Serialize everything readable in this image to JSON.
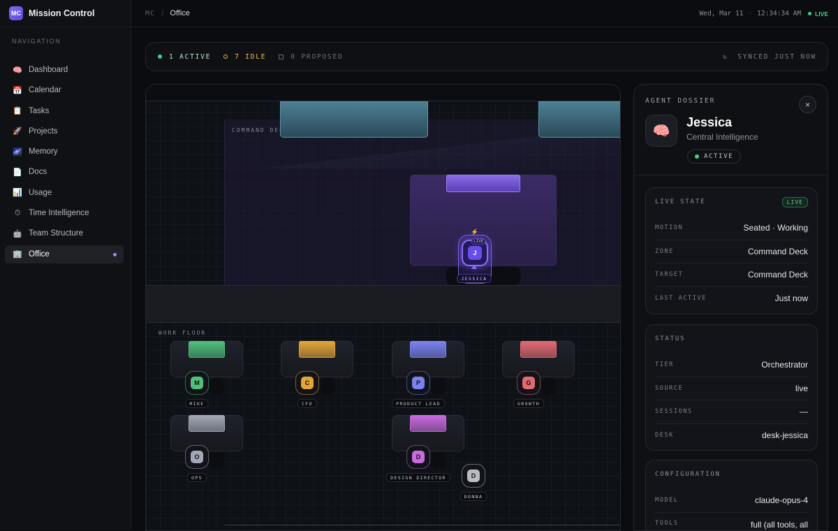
{
  "app": {
    "logo": "MC",
    "title": "Mission Control"
  },
  "sidebar": {
    "heading": "NAVIGATION",
    "items": [
      {
        "icon": "🧠",
        "icon_name": "brain-icon",
        "label": "Dashboard"
      },
      {
        "icon": "📅",
        "icon_name": "calendar-icon",
        "label": "Calendar"
      },
      {
        "icon": "📋",
        "icon_name": "clipboard-icon",
        "label": "Tasks"
      },
      {
        "icon": "🚀",
        "icon_name": "rocket-icon",
        "label": "Projects"
      },
      {
        "icon": "🌌",
        "icon_name": "galaxy-icon",
        "label": "Memory"
      },
      {
        "icon": "📄",
        "icon_name": "document-icon",
        "label": "Docs"
      },
      {
        "icon": "📊",
        "icon_name": "bar-chart-icon",
        "label": "Usage"
      },
      {
        "icon": "⏱",
        "icon_name": "stopwatch-icon",
        "label": "Time Intelligence"
      },
      {
        "icon": "🤖",
        "icon_name": "robot-icon",
        "label": "Team Structure"
      },
      {
        "icon": "🏢",
        "icon_name": "office-building-icon",
        "label": "Office",
        "active": true
      }
    ]
  },
  "topbar": {
    "breadcrumb_root": "MC",
    "breadcrumb_separator": "/",
    "breadcrumb_current": "Office",
    "date": "Wed, Mar 11",
    "separator": "·",
    "time": "12:34:34 AM",
    "live": "LIVE"
  },
  "status": {
    "active": "1 ACTIVE",
    "idle": "7 IDLE",
    "proposed": "0 PROPOSED",
    "synced_icon": "↻",
    "synced": "SYNCED JUST NOW",
    "colors": {
      "active": "#3fd48a",
      "idle": "#e6c15c",
      "proposed": "#6d7079"
    }
  },
  "office": {
    "command_deck_label": "COMMAND DECK",
    "work_floor_label": "WORK FLOOR",
    "jessica": {
      "initial": "J",
      "name": "JESSICA",
      "live_tag": "LIVE",
      "bolt": "⚡",
      "color": "#7c5cff"
    },
    "agents": [
      {
        "initial": "M",
        "name": "MIKE",
        "color": "#4fbf7c"
      },
      {
        "initial": "C",
        "name": "CFO",
        "color": "#e3a53a"
      },
      {
        "initial": "P",
        "name": "PRODUCT LEAD",
        "color": "#7b82f0"
      },
      {
        "initial": "G",
        "name": "GROWTH",
        "color": "#e36a72"
      },
      {
        "initial": "O",
        "name": "OPS",
        "color": "#a3a8b5"
      },
      {
        "initial": "D",
        "name": "DESIGN DIRECTOR",
        "color": "#c86be0"
      },
      {
        "initial": "D",
        "name": "DONNA",
        "color": "#b9bcc4"
      }
    ]
  },
  "dossier": {
    "label": "AGENT DOSSIER",
    "close_icon": "×",
    "avatar": "🧠",
    "name": "Jessica",
    "role": "Central Intelligence",
    "badge": "ACTIVE",
    "live_state": {
      "title": "LIVE STATE",
      "tag": "LIVE",
      "rows": [
        {
          "k": "MOTION",
          "v": "Seated · Working"
        },
        {
          "k": "ZONE",
          "v": "Command Deck"
        },
        {
          "k": "TARGET",
          "v": "Command Deck"
        },
        {
          "k": "LAST ACTIVE",
          "v": "Just now"
        }
      ]
    },
    "status": {
      "title": "STATUS",
      "rows": [
        {
          "k": "TIER",
          "v": "Orchestrator"
        },
        {
          "k": "SOURCE",
          "v": "live"
        },
        {
          "k": "SESSIONS",
          "v": "—"
        },
        {
          "k": "DESK",
          "v": "desk-jessica"
        }
      ]
    },
    "configuration": {
      "title": "CONFIGURATION",
      "rows": [
        {
          "k": "MODEL",
          "v": "claude-opus-4"
        },
        {
          "k": "TOOLS",
          "v": "full (all tools, all permissions)"
        }
      ]
    }
  }
}
